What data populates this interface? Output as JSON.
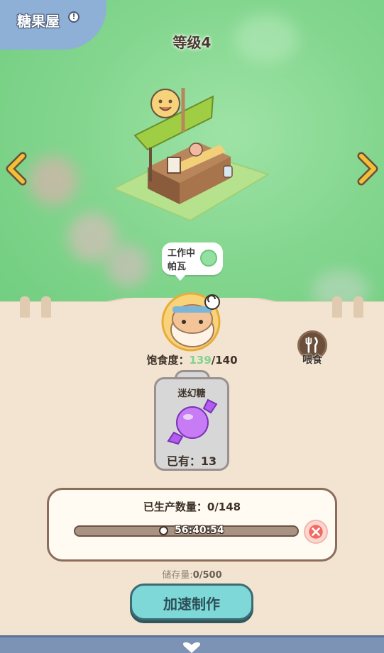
{
  "header": {
    "title": "糖果屋",
    "info_icon": "info-icon",
    "level": "等级4"
  },
  "nav": {
    "left_icon": "chevron-left-icon",
    "right_icon": "chevron-right-icon"
  },
  "status_bubble": {
    "line1": "工作中",
    "line2": "帕瓦",
    "icon": "smile-icon"
  },
  "worker": {
    "satiety_label": "饱食度：",
    "satiety_current": "139",
    "satiety_max": "/140",
    "feed_label": "喂食"
  },
  "item_card": {
    "name": "迷幻糖",
    "owned": "已有：13"
  },
  "production": {
    "title": "已生产数量：0/148",
    "timer": "56:40:54",
    "progress": 0,
    "storage_label": "储存量:",
    "storage_value": "0/500"
  },
  "actions": {
    "speed_up": "加速制作"
  },
  "colors": {
    "accent": "#7ed8d8",
    "satiety": "#7fd38c",
    "cancel": "#f06b61"
  }
}
